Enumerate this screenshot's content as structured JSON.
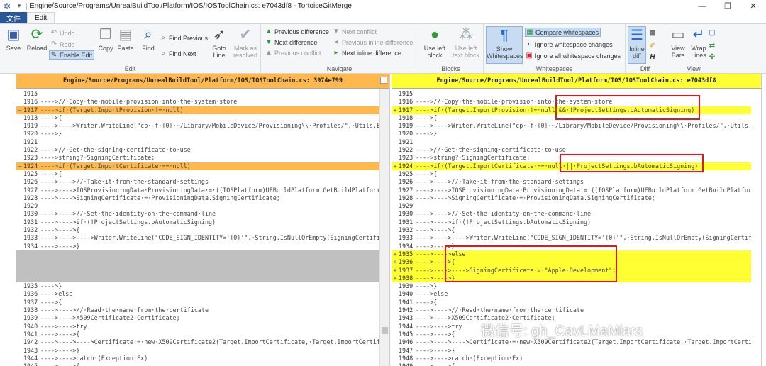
{
  "window": {
    "title": "Engine/Source/Programs/UnrealBuildTool/Platform/IOS/IOSToolChain.cs: e7043df8 - TortoiseGitMerge",
    "min": "—",
    "max": "❐",
    "close": "✕"
  },
  "tabs": {
    "file": "文件",
    "edit": "Edit"
  },
  "ribbon": {
    "edit": {
      "label": "Edit",
      "save": "Save",
      "reload": "Reload",
      "undo": "Undo",
      "redo": "Redo",
      "enable_edit": "Enable Edit",
      "copy": "Copy",
      "paste": "Paste",
      "find": "Find",
      "find_previous": "Find Previous",
      "find_next": "Find Next",
      "goto_line": "Goto Line",
      "mark_resolved": "Mark as resolved"
    },
    "navigate": {
      "label": "Navigate",
      "prev_diff": "Previous difference",
      "next_diff": "Next difference",
      "prev_conflict": "Previous conflict",
      "next_conflict": "Next conflict",
      "prev_inline": "Previous inline difference",
      "next_inline": "Next inline difference"
    },
    "blocks": {
      "label": "Blocks",
      "use_left_block": "Use left block",
      "use_left_text_block": "Use left text block"
    },
    "whitespaces": {
      "label": "Whitespaces",
      "show_whitespaces": "Show Whitespaces",
      "compare": "Compare whitespaces",
      "ignore_changes": "Ignore whitespace changes",
      "ignore_all": "Ignore all whitespace changes"
    },
    "diff": {
      "label": "Diff",
      "inline_diff": "Inline diff"
    },
    "view": {
      "label": "View",
      "view_bars": "View Bars",
      "wrap_lines": "Wrap Lines"
    }
  },
  "left": {
    "header": "Engine/Source/Programs/UnrealBuildTool/Platform/IOS/IOSToolChain.cs: 3974e799",
    "lines": [
      {
        "n": "1915",
        "c": "",
        "t": ""
      },
      {
        "n": "1916",
        "c": "---->//·Copy·the·mobile·provision·into·the·system·store",
        "t": ""
      },
      {
        "n": "1917",
        "c": "---->if·(Target.ImportProvision·!=·null)",
        "t": "mod",
        "m": "−"
      },
      {
        "n": "1918",
        "c": "---->{",
        "t": ""
      },
      {
        "n": "1919",
        "c": "---->---->Writer.WriteLine(\"cp·-f·{0}·~/Library/MobileDevice/Provisioning\\\\·Profiles/\",·Utils.Es",
        "t": ""
      },
      {
        "n": "1920",
        "c": "---->}",
        "t": ""
      },
      {
        "n": "1921",
        "c": "",
        "t": ""
      },
      {
        "n": "1922",
        "c": "---->//·Get·the·signing·certificate·to·use",
        "t": ""
      },
      {
        "n": "1923",
        "c": "---->string?·SigningCertificate;",
        "t": ""
      },
      {
        "n": "1924",
        "c": "---->if·(Target.ImportCertificate·==·null)",
        "t": "mod",
        "m": "−"
      },
      {
        "n": "1925",
        "c": "---->{",
        "t": ""
      },
      {
        "n": "1926",
        "c": "---->---->//·Take·it·from·the·standard·settings",
        "t": ""
      },
      {
        "n": "1927",
        "c": "---->---->IOSProvisioningData·ProvisioningData·=·((IOSPlatform)UEBuildPlatform.GetBuildPlatform",
        "t": ""
      },
      {
        "n": "1928",
        "c": "---->---->SigningCertificate·=·ProvisioningData.SigningCertificate;",
        "t": ""
      },
      {
        "n": "1929",
        "c": "",
        "t": ""
      },
      {
        "n": "1930",
        "c": "---->---->//·Set·the·identity·on·the·command·line",
        "t": ""
      },
      {
        "n": "1931",
        "c": "---->---->if·(!ProjectSettings.bAutomaticSigning)",
        "t": ""
      },
      {
        "n": "1932",
        "c": "---->---->{",
        "t": ""
      },
      {
        "n": "1933",
        "c": "---->---->---->Writer.WriteLine(\"CODE_SIGN_IDENTITY='{0}'\",·String.IsNullOrEmpty(SigningCertifica",
        "t": ""
      },
      {
        "n": "1934",
        "c": "---->---->}",
        "t": ""
      },
      {
        "n": "",
        "c": "",
        "t": "emp"
      },
      {
        "n": "",
        "c": "",
        "t": "emp"
      },
      {
        "n": "",
        "c": "",
        "t": "emp"
      },
      {
        "n": "",
        "c": "",
        "t": "emp"
      },
      {
        "n": "1935",
        "c": "---->}",
        "t": ""
      },
      {
        "n": "1936",
        "c": "---->else",
        "t": ""
      },
      {
        "n": "1937",
        "c": "---->{",
        "t": ""
      },
      {
        "n": "1938",
        "c": "---->---->//·Read·the·name·from·the·certificate",
        "t": ""
      },
      {
        "n": "1939",
        "c": "---->---->X509Certificate2·Certificate;",
        "t": ""
      },
      {
        "n": "1940",
        "c": "---->---->try",
        "t": ""
      },
      {
        "n": "1941",
        "c": "---->---->{",
        "t": ""
      },
      {
        "n": "1942",
        "c": "---->---->---->Certificate·=·new·X509Certificate2(Target.ImportCertificate,·Target.ImportCertifica",
        "t": ""
      },
      {
        "n": "1943",
        "c": "---->---->}",
        "t": ""
      },
      {
        "n": "1944",
        "c": "---->---->catch·(Exception·Ex)",
        "t": ""
      },
      {
        "n": "1945",
        "c": "---->---->{",
        "t": ""
      }
    ]
  },
  "right": {
    "header": "Engine/Source/Programs/UnrealBuildTool/Platform/IOS/IOSToolChain.cs: e7043df8",
    "lines": [
      {
        "n": "1915",
        "c": "",
        "t": ""
      },
      {
        "n": "1916",
        "c": "---->//·Copy·the·mobile·provision·into·the·system·store",
        "t": ""
      },
      {
        "n": "1917",
        "c": "---->if·(Target.ImportProvision·!=·null·&&·!ProjectSettings.bAutomaticSigning)",
        "t": "modr",
        "m": "+"
      },
      {
        "n": "1918",
        "c": "---->{",
        "t": ""
      },
      {
        "n": "1919",
        "c": "---->---->Writer.WriteLine(\"cp·-f·{0}·~/Library/MobileDevice/Provisioning\\\\·Profiles/\",·Utils.Es",
        "t": ""
      },
      {
        "n": "1920",
        "c": "---->}",
        "t": ""
      },
      {
        "n": "1921",
        "c": "",
        "t": ""
      },
      {
        "n": "1922",
        "c": "---->//·Get·the·signing·certificate·to·use",
        "t": ""
      },
      {
        "n": "1923",
        "c": "---->string?·SigningCertificate;",
        "t": ""
      },
      {
        "n": "1924",
        "c": "---->if·(Target.ImportCertificate·==·null·||·ProjectSettings.bAutomaticSigning)",
        "t": "modr",
        "m": "+"
      },
      {
        "n": "1925",
        "c": "---->{",
        "t": ""
      },
      {
        "n": "1926",
        "c": "---->---->//·Take·it·from·the·standard·settings",
        "t": ""
      },
      {
        "n": "1927",
        "c": "---->---->IOSProvisioningData·ProvisioningData·=·((IOSPlatform)UEBuildPlatform.GetBuildPlatform",
        "t": ""
      },
      {
        "n": "1928",
        "c": "---->---->SigningCertificate·=·ProvisioningData.SigningCertificate;",
        "t": ""
      },
      {
        "n": "1929",
        "c": "",
        "t": ""
      },
      {
        "n": "1930",
        "c": "---->---->//·Set·the·identity·on·the·command·line",
        "t": ""
      },
      {
        "n": "1931",
        "c": "---->---->if·(!ProjectSettings.bAutomaticSigning)",
        "t": ""
      },
      {
        "n": "1932",
        "c": "---->---->{",
        "t": ""
      },
      {
        "n": "1933",
        "c": "---->---->---->Writer.WriteLine(\"CODE_SIGN_IDENTITY='{0}'\",·String.IsNullOrEmpty(SigningCertifica",
        "t": ""
      },
      {
        "n": "1934",
        "c": "---->---->}",
        "t": ""
      },
      {
        "n": "1935",
        "c": "---->---->else",
        "t": "add",
        "m": "+"
      },
      {
        "n": "1936",
        "c": "---->---->{",
        "t": "add",
        "m": "+"
      },
      {
        "n": "1937",
        "c": "---->---->---->SigningCertificate·=·\"Apple·Development\";",
        "t": "add",
        "m": "+"
      },
      {
        "n": "1938",
        "c": "---->---->}",
        "t": "add",
        "m": "+"
      },
      {
        "n": "1939",
        "c": "---->}",
        "t": ""
      },
      {
        "n": "1940",
        "c": "---->else",
        "t": ""
      },
      {
        "n": "1941",
        "c": "---->{",
        "t": ""
      },
      {
        "n": "1942",
        "c": "---->---->//·Read·the·name·from·the·certificate",
        "t": ""
      },
      {
        "n": "1943",
        "c": "---->---->X509Certificate2·Certificate;",
        "t": ""
      },
      {
        "n": "1944",
        "c": "---->---->try",
        "t": ""
      },
      {
        "n": "1945",
        "c": "---->---->{",
        "t": ""
      },
      {
        "n": "1946",
        "c": "---->---->---->Certificate·=·new·X509Certificate2(Target.ImportCertificate,·Target.ImportCertifi",
        "t": ""
      },
      {
        "n": "1947",
        "c": "---->---->}",
        "t": ""
      },
      {
        "n": "1948",
        "c": "---->---->catch·(Exception·Ex)",
        "t": ""
      },
      {
        "n": "1949",
        "c": "---->---->{",
        "t": ""
      }
    ]
  },
  "watermark": "微信号: gh_CavLMaMiars",
  "colors": {
    "left_header": "#ffb84c",
    "right_header": "#ffff33",
    "removed": "#ffb84c",
    "added": "#ffff33",
    "empty": "#c0c0c0",
    "annotation": "#e0191d"
  }
}
